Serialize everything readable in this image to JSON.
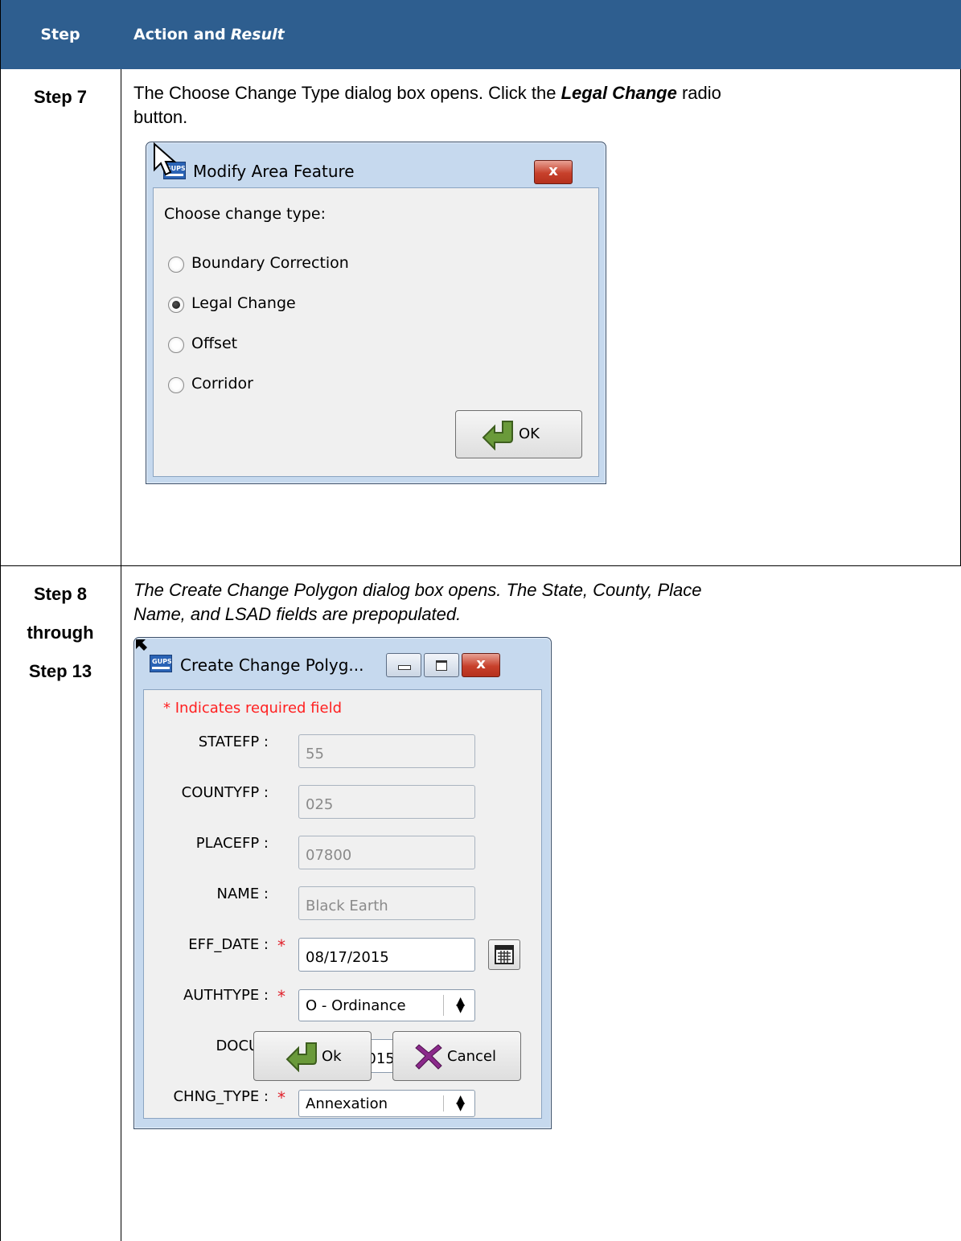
{
  "header": {
    "step_col": "Step",
    "action_col_prefix": "Action and",
    "action_col_italic": "Result"
  },
  "step7": {
    "label": "Step 7",
    "text_part1": "The Choose Change Type dialog box opens.  Click the ",
    "text_bold": "Legal Change",
    "text_part2": " radio",
    "text_line2": "button.",
    "dialog": {
      "icon_text": "GUPS",
      "title": "Modify Area Feature",
      "close_label": "x",
      "prompt": "Choose change type:",
      "options": [
        {
          "label": "Boundary Correction",
          "checked": false
        },
        {
          "label": "Legal Change",
          "checked": true
        },
        {
          "label": "Offset",
          "checked": false
        },
        {
          "label": "Corridor",
          "checked": false
        }
      ],
      "ok_label": "OK"
    }
  },
  "step8": {
    "label_line1": "Step 8",
    "label_line2": "through",
    "label_line3": "Step 13",
    "text_line1": "The Create Change Polygon dialog box opens. The State, County, Place",
    "text_line2": "Name, and LSAD fields are prepopulated.",
    "dialog": {
      "icon_text": "GUPS",
      "title": "Create Change Polyg...",
      "close_label": "x",
      "required_note": "* Indicates required field",
      "fields": {
        "statefp": {
          "label": "STATEFP :",
          "value": "55"
        },
        "countyfp": {
          "label": "COUNTYFP :",
          "value": "025"
        },
        "placefp": {
          "label": "PLACEFP :",
          "value": "07800"
        },
        "name": {
          "label": "NAME :",
          "value": "Black Earth"
        },
        "eff_date": {
          "label": "EFF_DATE :",
          "value": "08/17/2015"
        },
        "authtype": {
          "label": "AUTHTYPE :",
          "value": "O - Ordinance"
        },
        "docu": {
          "label": "DOCU :",
          "value": "ORD-9-2015"
        },
        "chng_type": {
          "label": "CHNG_TYPE :",
          "value": "Annexation"
        }
      },
      "required_mark": "*",
      "ok_label": "Ok",
      "cancel_label": "Cancel"
    }
  },
  "colors": {
    "header_bg": "#2e5e8f",
    "required": "#e0202a"
  }
}
